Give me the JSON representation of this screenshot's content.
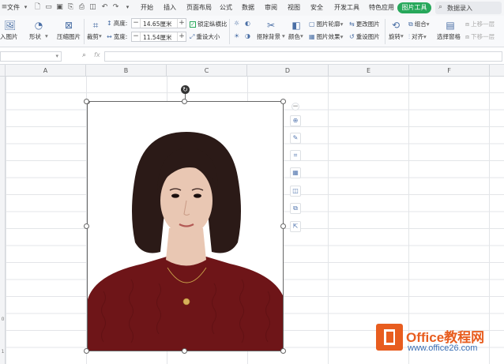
{
  "menubar": {
    "file_menu": "文件",
    "tabs": [
      {
        "label": "开始"
      },
      {
        "label": "插入"
      },
      {
        "label": "页面布局"
      },
      {
        "label": "公式"
      },
      {
        "label": "数据"
      },
      {
        "label": "审阅"
      },
      {
        "label": "视图"
      },
      {
        "label": "安全"
      },
      {
        "label": "开发工具"
      },
      {
        "label": "特色应用"
      }
    ],
    "active_tab": "图片工具",
    "search_placeholder": "数据录入"
  },
  "ribbon": {
    "insert_picture": "入图片",
    "shape": "形状",
    "compress": "压缩图片",
    "crop": "裁剪",
    "height_label": "高度:",
    "height_value": "14.65厘米",
    "width_label": "宽度:",
    "width_value": "11.54厘米",
    "lock_ratio": "锁定纵横比",
    "reset_size": "重设大小",
    "remove_bg": "抠除背景",
    "color": "颜色",
    "picture_outline": "图片轮廓",
    "picture_effect": "图片效果",
    "change_picture": "更改图片",
    "reset_picture": "重设图片",
    "rotate": "旋转",
    "group": "组合",
    "align": "对齐",
    "selection_pane": "选择窗格",
    "bring_forward": "上移一层",
    "send_backward": "下移一层"
  },
  "formula_bar": {
    "fx": "fx"
  },
  "columns": [
    "A",
    "B",
    "C",
    "D",
    "E",
    "F"
  ],
  "row_labels": [
    "0",
    "1"
  ],
  "picture": {
    "colors": {
      "hair": "#2b1a17",
      "skin": "#e9c7b3",
      "sweater": "#6e1518",
      "handle_border": "#666666"
    }
  },
  "watermark": {
    "title": "Office教程网",
    "url": "www.office26.com"
  },
  "colors": {
    "accent_green": "#27a85b",
    "brand_orange": "#e85d1f",
    "link_blue": "#3a6fb5"
  }
}
